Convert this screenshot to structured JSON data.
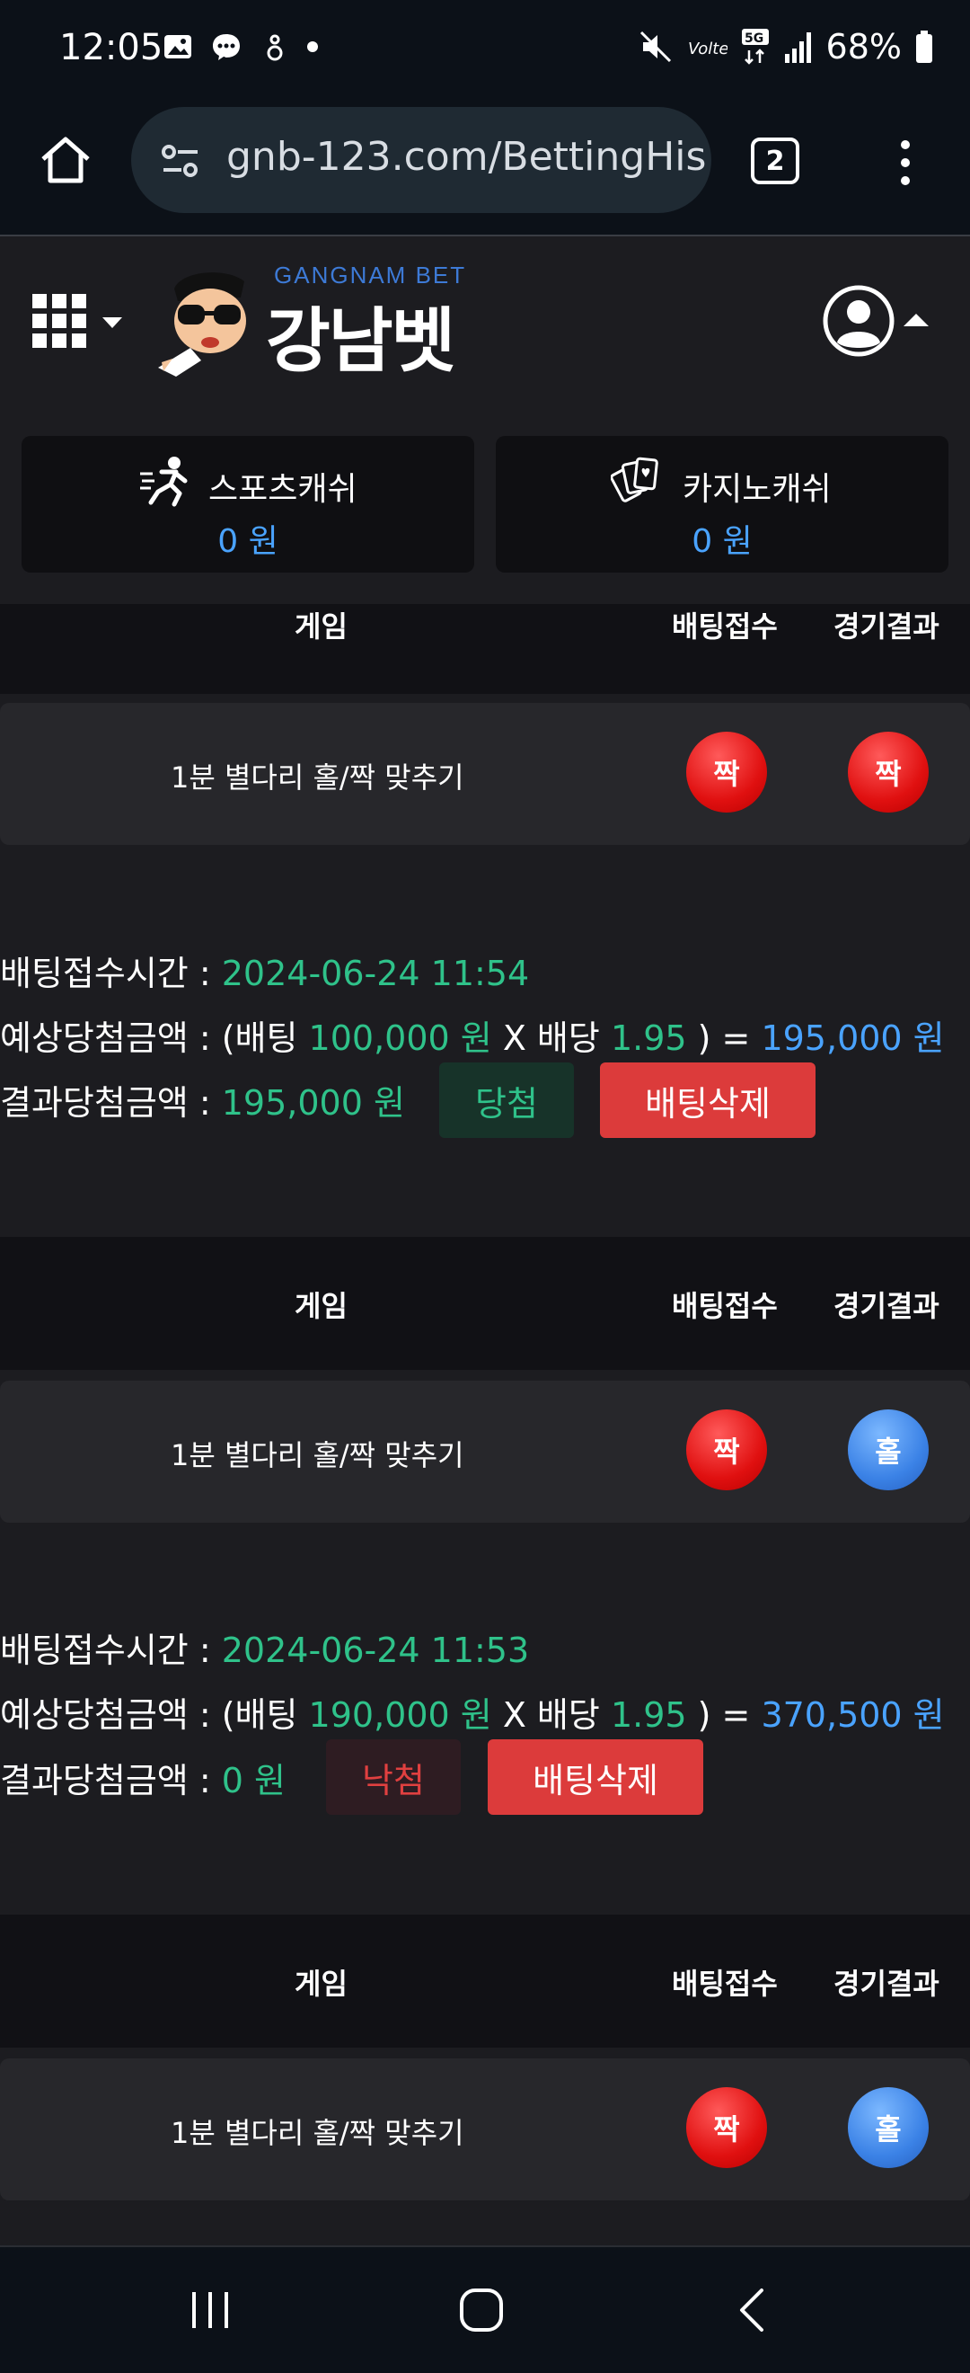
{
  "status_bar": {
    "time": "12:05",
    "battery": "68%",
    "network": "5G"
  },
  "browser": {
    "url": "gnb-123.com/BettingHis",
    "tab_count": "2"
  },
  "site": {
    "logo_sub": "GANGNAM BET",
    "logo_main": "강남벳"
  },
  "cash": {
    "sports_label": "스포츠캐쉬",
    "sports_value": "0 원",
    "casino_label": "카지노캐쉬",
    "casino_value": "0 원"
  },
  "table_headers": {
    "game": "게임",
    "pick": "배팅접수",
    "result": "경기결과"
  },
  "bets": [
    {
      "game": "1분 별다리 홀/짝 맞추기",
      "pick": "짝",
      "result": "짝",
      "time_label": "배팅접수시간 : ",
      "time": "2024-06-24 11:54",
      "expected_label": "예상당첨금액 : (배팅 ",
      "stake": "100,000 원",
      "x_label": " X 배당 ",
      "odds": "1.95",
      "eq_label": " ) = ",
      "expected": "195,000 원",
      "win_label": "결과당첨금액 : ",
      "win_amount": "195,000 원",
      "status": "당첨",
      "delete": "배팅삭제"
    },
    {
      "game": "1분 별다리 홀/짝 맞추기",
      "pick": "짝",
      "result": "홀",
      "time_label": "배팅접수시간 : ",
      "time": "2024-06-24 11:53",
      "expected_label": "예상당첨금액 : (배팅 ",
      "stake": "190,000 원",
      "x_label": " X 배당 ",
      "odds": "1.95",
      "eq_label": " ) = ",
      "expected": "370,500 원",
      "win_label": "결과당첨금액 : ",
      "win_amount": "0 원",
      "status": "낙첨",
      "delete": "배팅삭제"
    },
    {
      "game": "1분 별다리 홀/짝 맞추기",
      "pick": "짝",
      "result": "홀"
    }
  ],
  "colors": {
    "win": "#2fc28a",
    "amount": "#4aa3ff",
    "delete": "#dc3b3b",
    "odd_ball": "#3b82e6",
    "even_ball": "#e01010"
  }
}
